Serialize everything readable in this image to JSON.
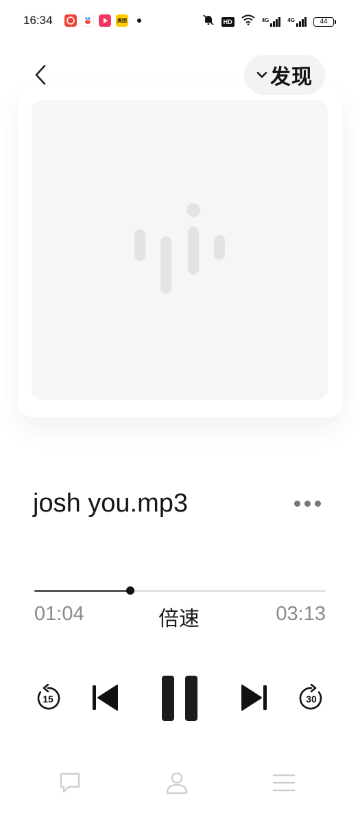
{
  "status_bar": {
    "time": "16:34",
    "app_icons": [
      {
        "name": "red-app-icon",
        "color": "#f0443a"
      },
      {
        "name": "baidu-app-icon",
        "color": "#e84d3d"
      },
      {
        "name": "video-app-icon",
        "color": "#f2365d"
      },
      {
        "name": "meituan-app-icon",
        "color": "#ffcc00",
        "label": "美团"
      }
    ],
    "hd_label": "HD",
    "net1_label": "4G",
    "net2_label": "4G",
    "battery": "44"
  },
  "header": {
    "discover_label": "发现"
  },
  "track": {
    "title": "josh you.mp3"
  },
  "progress": {
    "elapsed": "01:04",
    "total": "03:13",
    "fraction": 0.33,
    "speed_label": "倍速"
  },
  "controls": {
    "rewind_seconds": "15",
    "forward_seconds": "30"
  },
  "colors": {
    "accent": "#111111",
    "muted_text": "#8a8a8a",
    "cover_bg": "#f6f6f6",
    "nav_icon": "#cfcfcf"
  }
}
